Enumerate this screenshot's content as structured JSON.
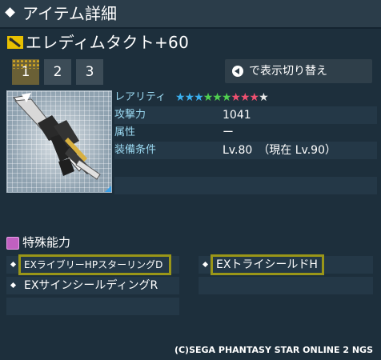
{
  "window": {
    "title": "アイテム詳細"
  },
  "item": {
    "name": "エレディムタクト+60",
    "icon": "weapon-class-icon"
  },
  "tabs": [
    {
      "label": "1",
      "active": true
    },
    {
      "label": "2",
      "active": false
    },
    {
      "label": "3",
      "active": false
    }
  ],
  "switch_button": {
    "label": "で表示切り替え",
    "icon": "button-left-icon"
  },
  "properties": {
    "rarity_label": "レアリティ",
    "rarity_stars": 10,
    "rarity_star_colors": [
      "#3ab0f0",
      "#3ab0f0",
      "#3ab0f0",
      "#50d050",
      "#50d050",
      "#50d050",
      "#f05070",
      "#f05070",
      "#f05070",
      "#e8e8e8"
    ],
    "attack_label": "攻撃力",
    "attack_value": "1041",
    "element_label": "属性",
    "element_value": "ー",
    "requirement_label": "装備条件",
    "requirement_value": "Lv.80　（現在  Lv.90）"
  },
  "special_abilities": {
    "label": "特殊能力",
    "items": [
      {
        "text": "EXライブリーHPスターリングD",
        "highlighted": true
      },
      {
        "text": "EXトライシールドH",
        "highlighted": true
      },
      {
        "text": "EXサインシールディングR",
        "highlighted": false
      }
    ]
  },
  "copyright": "(C)SEGA PHANTASY STAR ONLINE 2 NGS",
  "colors": {
    "highlight": "#9a9618",
    "accent_label": "#9ad8f0",
    "background": "#1d2f3c"
  }
}
